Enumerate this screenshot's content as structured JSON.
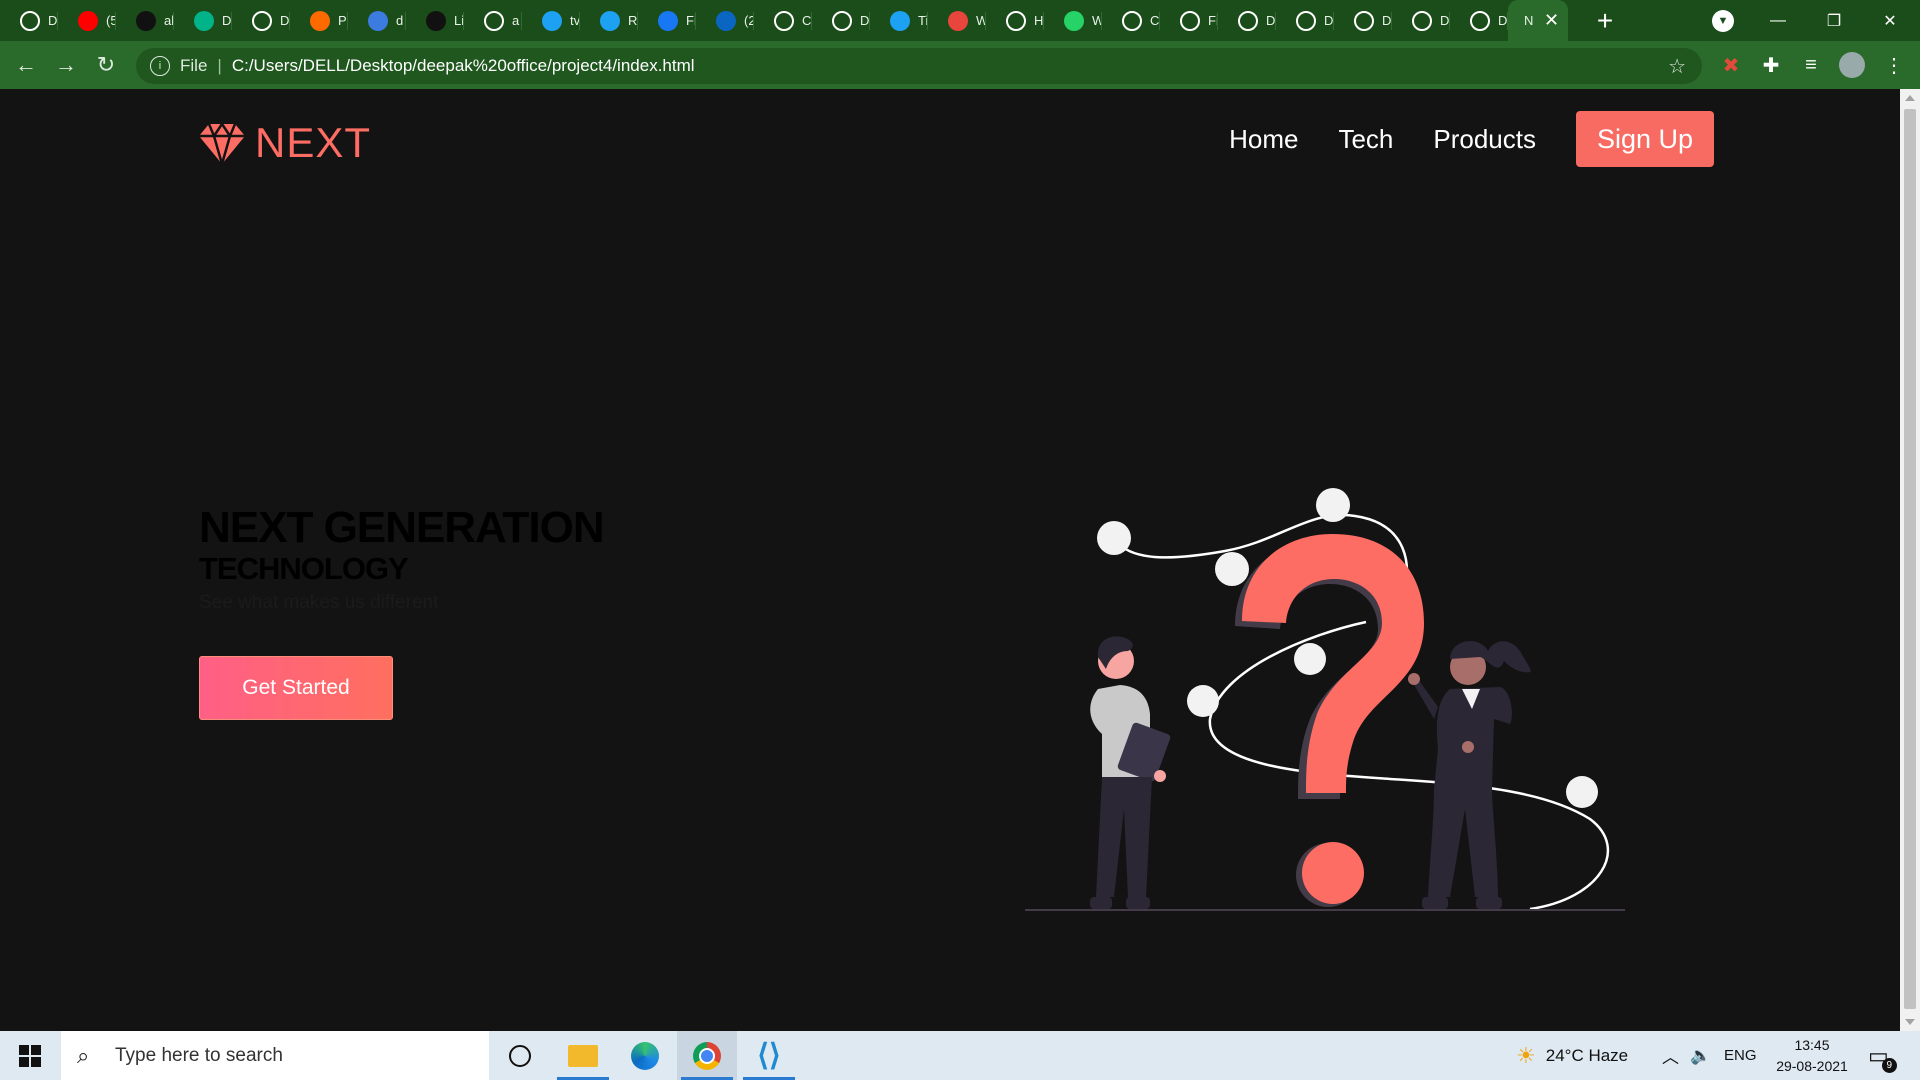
{
  "browser": {
    "tabs": [
      {
        "icon": "chrome-globe-icon",
        "title": "D",
        "color": "#ffffff"
      },
      {
        "icon": "youtube-icon",
        "title": "(5",
        "color": "#ff0000"
      },
      {
        "icon": "github-icon",
        "title": "al",
        "color": "#111111"
      },
      {
        "icon": "diamond-icon",
        "title": "D",
        "color": "#00b388"
      },
      {
        "icon": "chrome-globe-icon",
        "title": "D",
        "color": "#ffffff"
      },
      {
        "icon": "xd-icon",
        "title": "Pi",
        "color": "#ff6a00"
      },
      {
        "icon": "c-icon",
        "title": "d",
        "color": "#3c7be0"
      },
      {
        "icon": "glitch-icon",
        "title": "Li",
        "color": "#111111"
      },
      {
        "icon": "google-icon",
        "title": "a",
        "color": "#ffffff"
      },
      {
        "icon": "twitter-icon",
        "title": "tv",
        "color": "#1da1f2"
      },
      {
        "icon": "twitter-icon",
        "title": "R",
        "color": "#1da1f2"
      },
      {
        "icon": "facebook-icon",
        "title": "Fi",
        "color": "#1877f2"
      },
      {
        "icon": "linkedin-icon",
        "title": "(2",
        "color": "#0a66c2"
      },
      {
        "icon": "chrome-globe-icon",
        "title": "C",
        "color": "#ffffff"
      },
      {
        "icon": "chrome-globe-icon",
        "title": "D",
        "color": "#ffffff"
      },
      {
        "icon": "twitter-icon",
        "title": "Ti",
        "color": "#1da1f2"
      },
      {
        "icon": "alert-icon",
        "title": "W",
        "color": "#e8453c"
      },
      {
        "icon": "chrome-globe-icon",
        "title": "H",
        "color": "#ffffff"
      },
      {
        "icon": "whatsapp-icon",
        "title": "W",
        "color": "#25d366"
      },
      {
        "icon": "chrome-globe-icon",
        "title": "C",
        "color": "#ffffff"
      },
      {
        "icon": "chrome-globe-icon",
        "title": "Fi",
        "color": "#ffffff"
      },
      {
        "icon": "chrome-globe-icon",
        "title": "D",
        "color": "#ffffff"
      },
      {
        "icon": "chrome-globe-icon",
        "title": "D",
        "color": "#ffffff"
      },
      {
        "icon": "chrome-globe-icon",
        "title": "D",
        "color": "#ffffff"
      },
      {
        "icon": "chrome-globe-icon",
        "title": "D",
        "color": "#ffffff"
      },
      {
        "icon": "chrome-globe-icon",
        "title": "D",
        "color": "#ffffff"
      }
    ],
    "active_tab": {
      "title": "N"
    },
    "address": {
      "scheme_label": "File",
      "url": "C:/Users/DELL/Desktop/deepak%20office/project4/index.html"
    }
  },
  "site": {
    "brand": "NEXT",
    "accent": "#fd6d63",
    "nav": {
      "home": "Home",
      "tech": "Tech",
      "products": "Products",
      "signup": "Sign Up"
    },
    "hero": {
      "title": "NEXT GENERATION",
      "subtitle": "TECHNOLOGY",
      "tagline": "See what makes us different",
      "cta": "Get Started"
    }
  },
  "taskbar": {
    "search_placeholder": "Type here to search",
    "weather": "24°C  Haze",
    "language": "ENG",
    "time": "13:45",
    "date": "29-08-2021",
    "notification_count": "9"
  }
}
